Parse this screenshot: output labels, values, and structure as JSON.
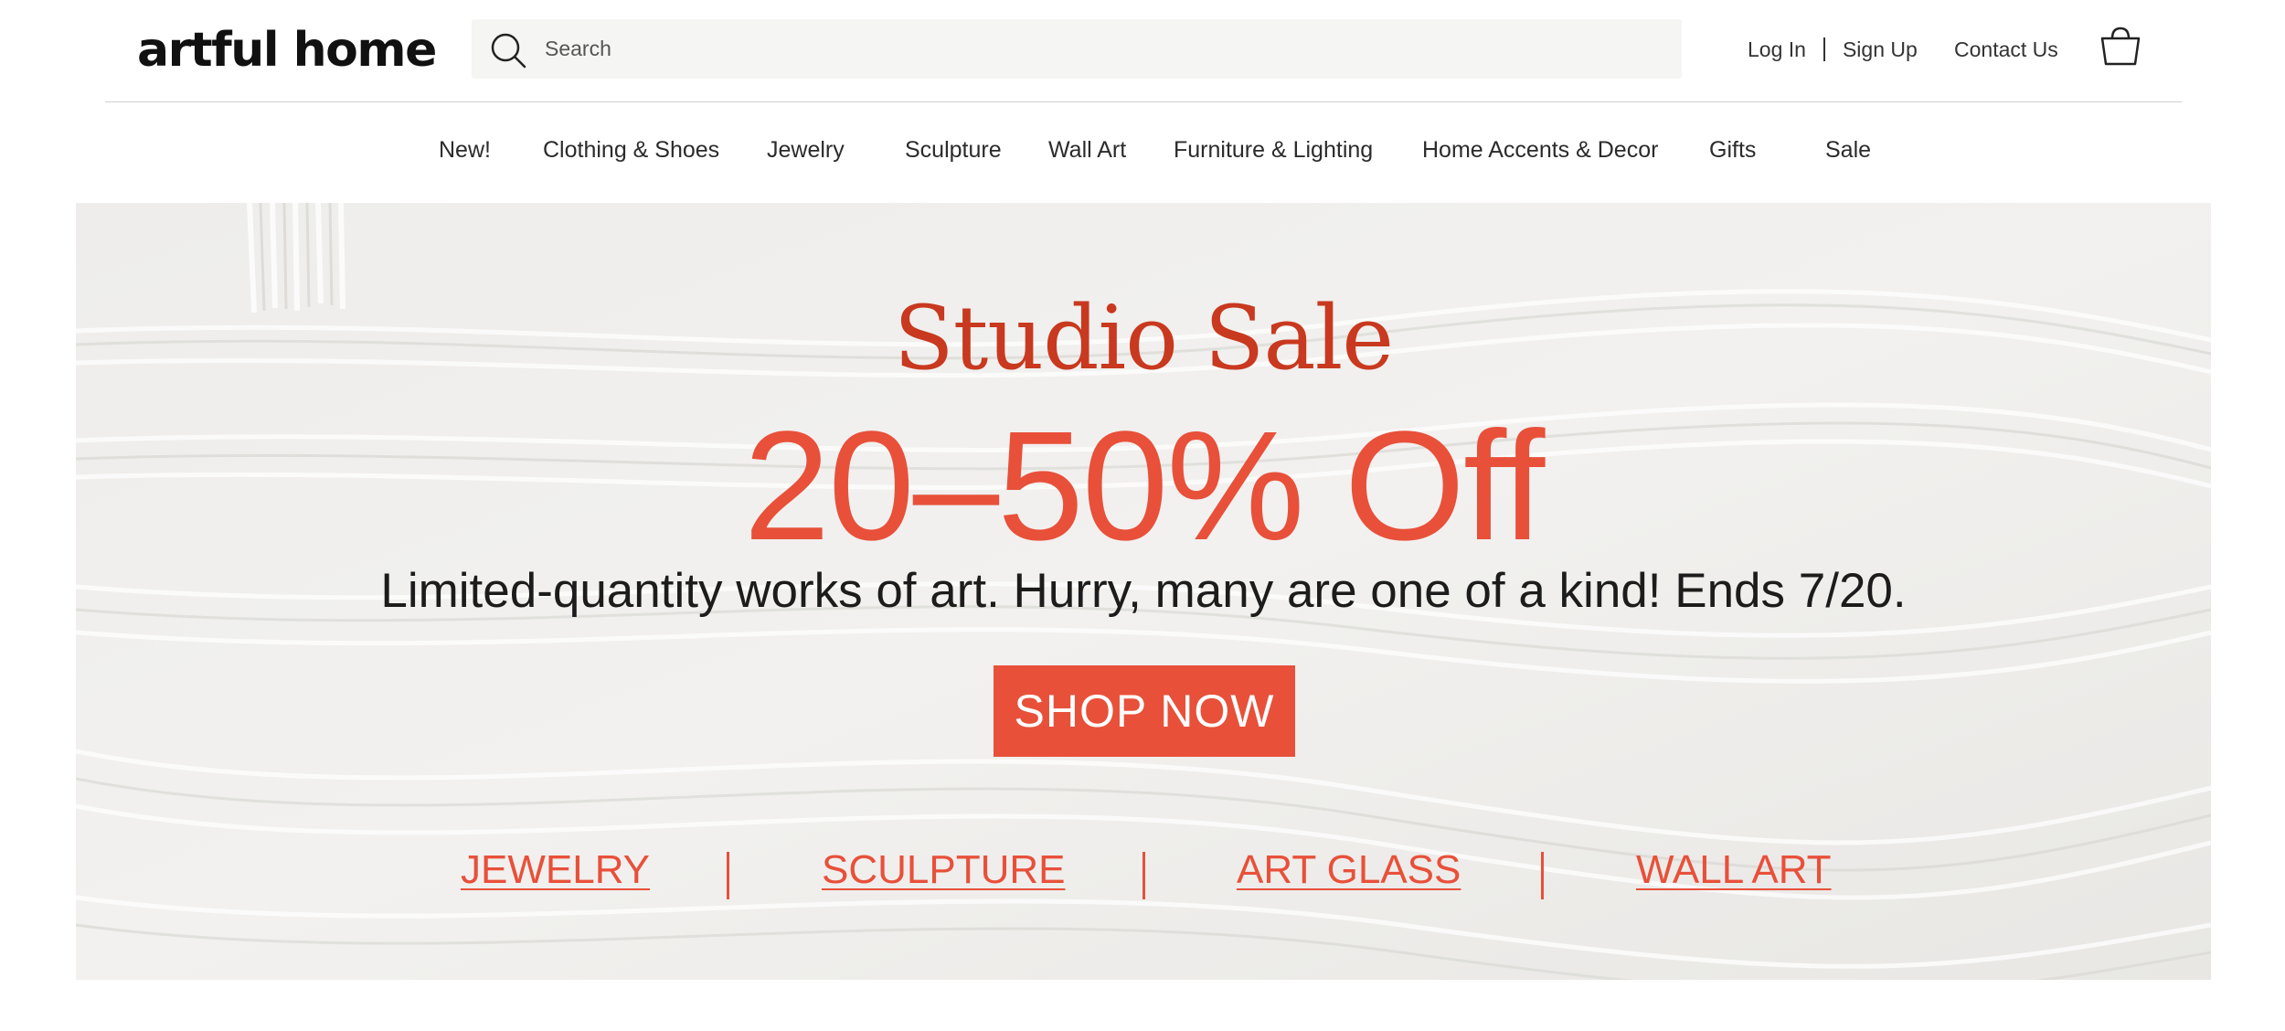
{
  "header": {
    "logo_text": "artful home",
    "search_placeholder": "Search",
    "login_label": "Log In",
    "signup_label": "Sign Up",
    "contact_label": "Contact Us",
    "icons": {
      "search": "search-icon",
      "cart": "shopping-bag-icon"
    }
  },
  "nav": {
    "items": [
      {
        "label": "New!"
      },
      {
        "label": "Clothing & Shoes"
      },
      {
        "label": "Jewelry"
      },
      {
        "label": "Sculpture"
      },
      {
        "label": "Wall Art"
      },
      {
        "label": "Furniture & Lighting"
      },
      {
        "label": "Home Accents & Decor"
      },
      {
        "label": "Gifts"
      },
      {
        "label": "Sale"
      }
    ]
  },
  "hero": {
    "title": "Studio Sale",
    "discount": "20–50% Off",
    "tagline": "Limited-quantity works of art. Hurry, many are one of a kind! Ends 7/20.",
    "cta_label": "SHOP NOW",
    "categories": [
      {
        "label": "JEWELRY"
      },
      {
        "label": "SCULPTURE"
      },
      {
        "label": "ART GLASS"
      },
      {
        "label": "WALL ART"
      }
    ]
  },
  "colors": {
    "accent": "#e8503a",
    "title_red": "#c8391f",
    "hero_bg": "#ecebe8",
    "search_bg": "#f5f5f4"
  }
}
